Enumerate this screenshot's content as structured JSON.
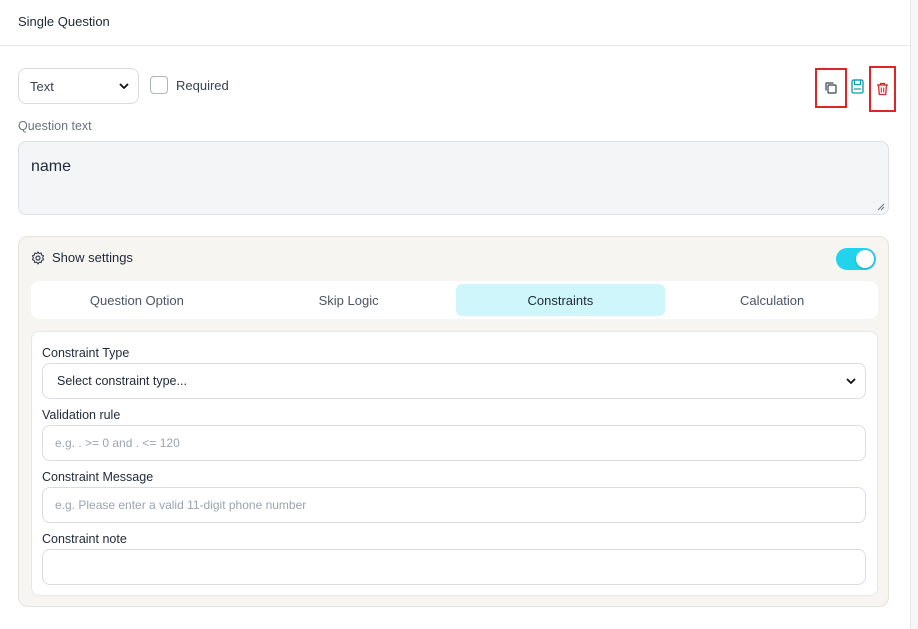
{
  "header": {
    "title": "Single Question"
  },
  "question": {
    "type_value": "Text",
    "required_label": "Required",
    "text_label": "Question text",
    "text_value": "name"
  },
  "actions": {
    "copy_icon": "copy-icon",
    "save_icon": "save-icon",
    "delete_icon": "trash-icon"
  },
  "settings": {
    "label": "Show settings",
    "toggle_on": true,
    "tabs": [
      {
        "label": "Question Option",
        "active": false
      },
      {
        "label": "Skip Logic",
        "active": false
      },
      {
        "label": "Constraints",
        "active": true
      },
      {
        "label": "Calculation",
        "active": false
      }
    ]
  },
  "constraints": {
    "type_label": "Constraint Type",
    "type_value": "Select constraint type...",
    "rule_label": "Validation rule",
    "rule_placeholder": "e.g. . >= 0 and . <= 120",
    "message_label": "Constraint Message",
    "message_placeholder": "e.g. Please enter a valid 11-digit phone number",
    "note_label": "Constraint note",
    "note_value": ""
  },
  "colors": {
    "accent": "#22d3ee",
    "active_tab": "#cff7fb",
    "delete": "#dc2626",
    "save": "#0e9aa7"
  }
}
